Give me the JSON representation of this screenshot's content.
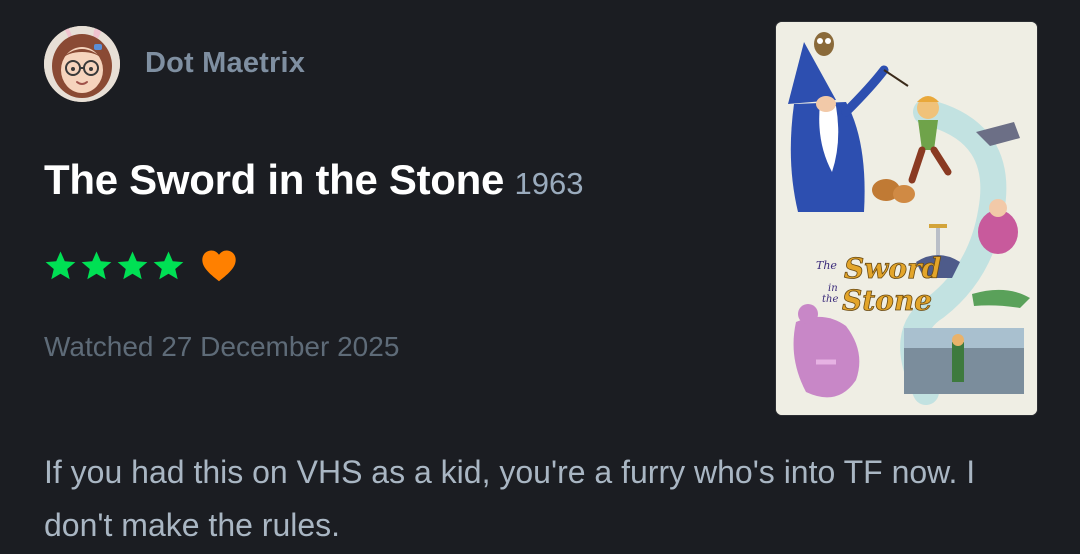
{
  "review_card": {
    "username": "Dot Maetrix",
    "film_title": "The Sword in the Stone",
    "film_year": "1963",
    "rating_stars": 4,
    "liked": true,
    "watched_text": "Watched 27 December 2025",
    "review_text": "If you had this on VHS as a kid, you're a furry who's into TF now. I don't make the rules.",
    "poster": {
      "title_line_1": "The",
      "title_line_2": "Sword",
      "title_line_3": "in",
      "title_line_4": "the",
      "title_line_5": "Stone"
    }
  },
  "colors": {
    "background": "#1b1d22",
    "star": "#00e054",
    "heart": "#ff8000",
    "username": "#7f8fa1",
    "year": "#9aabbd",
    "watched": "#5e6b78",
    "review": "#a9b6c3"
  },
  "icons": {
    "star": "star-icon",
    "heart": "heart-icon"
  }
}
